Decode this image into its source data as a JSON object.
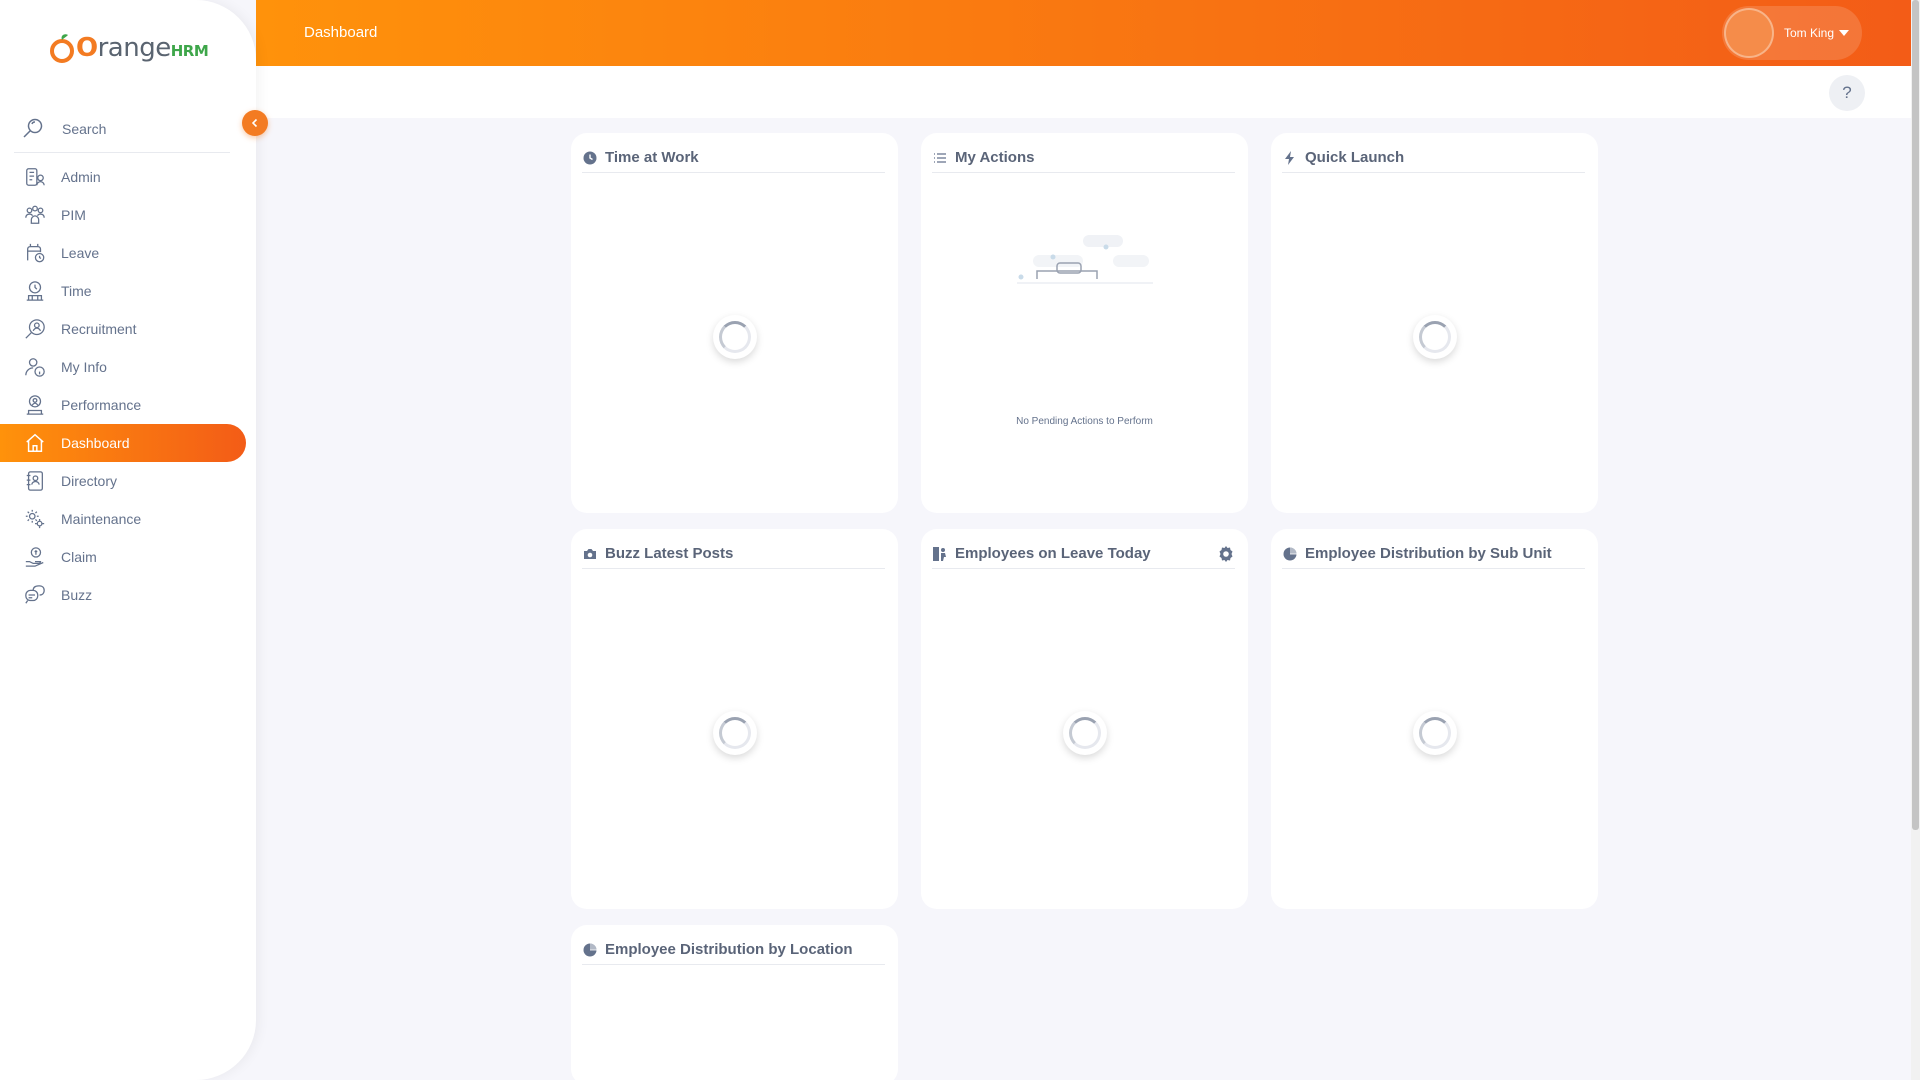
{
  "brand": {
    "name_main": "range",
    "name_first": "O",
    "name_suffix": "HRM"
  },
  "search": {
    "label": "Search"
  },
  "menu": [
    {
      "label": "Admin",
      "icon": "admin-icon"
    },
    {
      "label": "PIM",
      "icon": "pim-icon"
    },
    {
      "label": "Leave",
      "icon": "leave-icon"
    },
    {
      "label": "Time",
      "icon": "time-icon"
    },
    {
      "label": "Recruitment",
      "icon": "recruitment-icon"
    },
    {
      "label": "My Info",
      "icon": "my-info-icon"
    },
    {
      "label": "Performance",
      "icon": "performance-icon"
    },
    {
      "label": "Dashboard",
      "icon": "dashboard-icon",
      "active": true
    },
    {
      "label": "Directory",
      "icon": "directory-icon"
    },
    {
      "label": "Maintenance",
      "icon": "maintenance-icon"
    },
    {
      "label": "Claim",
      "icon": "claim-icon"
    },
    {
      "label": "Buzz",
      "icon": "buzz-icon"
    }
  ],
  "header": {
    "title": "Dashboard",
    "user_name": "Tom King"
  },
  "help": {
    "label": "?"
  },
  "widgets": {
    "time_at_work": {
      "title": "Time at Work",
      "icon": "clock-icon"
    },
    "my_actions": {
      "title": "My Actions",
      "icon": "list-icon",
      "empty_text": "No Pending Actions to Perform"
    },
    "quick_launch": {
      "title": "Quick Launch",
      "icon": "lightning-icon"
    },
    "buzz_latest": {
      "title": "Buzz Latest Posts",
      "icon": "camera-icon"
    },
    "leave_today": {
      "title": "Employees on Leave Today",
      "icon": "leave-person-icon"
    },
    "dist_subunit": {
      "title": "Employee Distribution by Sub Unit",
      "icon": "pie-icon"
    },
    "dist_location": {
      "title": "Employee Distribution by Location",
      "icon": "pie-icon"
    }
  },
  "colors": {
    "accent_start": "#ff920b",
    "accent_end": "#f35c17",
    "brand_green": "#3ea64a"
  }
}
